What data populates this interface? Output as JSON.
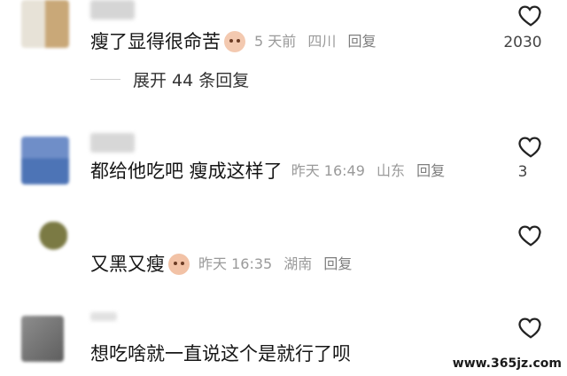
{
  "comments": [
    {
      "text": "瘦了显得很命苦",
      "time": "5 天前",
      "location": "四川",
      "reply_label": "回复",
      "likes": "2030",
      "expand_label": "展开 44 条回复"
    },
    {
      "text": "都给他吃吧 瘦成这样了",
      "time": "昨天 16:49",
      "location": "山东",
      "reply_label": "回复",
      "likes": "3"
    },
    {
      "text": "又黑又瘦",
      "time": "昨天 16:35",
      "location": "湖南",
      "reply_label": "回复",
      "likes": ""
    },
    {
      "text": "想吃啥就一直说这个是就行了呗",
      "likes": ""
    }
  ],
  "icons": {
    "like": "heart-outline-icon",
    "emoji1": "smile-face-emoji",
    "emoji2": "crying-face-emoji"
  },
  "watermark": "www.365jz.com",
  "colors": {
    "meta": "#9a9a9a",
    "text": "#161616",
    "heart": "#222222"
  }
}
